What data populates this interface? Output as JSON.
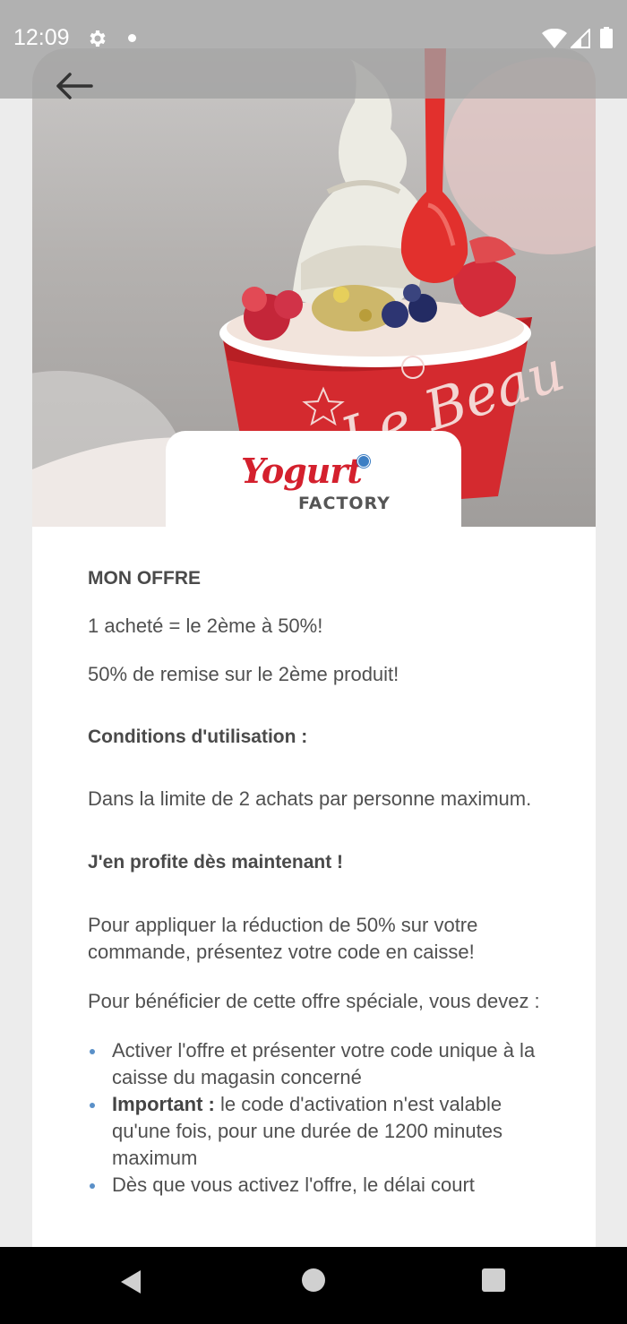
{
  "status_bar": {
    "time": "12:09",
    "icons": [
      "gear-icon",
      "dot-icon",
      "wifi-icon",
      "signal-icon",
      "battery-icon"
    ]
  },
  "header": {
    "back_icon": "arrow-left-icon"
  },
  "hero": {
    "cup_text": "Le Beau"
  },
  "brand": {
    "logo_script": "Yogurt",
    "logo_sub": "FACTORY"
  },
  "offer": {
    "title": "MON OFFRE",
    "deal": "1 acheté = le 2ème à 50%!",
    "deal_detail": "50% de remise sur le 2ème produit!",
    "conditions_title": "Conditions d'utilisation :",
    "conditions_text": "Dans la limite de 2 achats par personne maximum.",
    "cta_title": "J'en profite dès maintenant !",
    "cta_text": "Pour appliquer la réduction de 50% sur votre commande, présentez votre code en caisse!",
    "steps_intro": "Pour bénéficier de cette offre spéciale, vous devez :",
    "bullets": [
      {
        "text": "Activer l'offre et présenter votre code unique à la caisse du magasin concerné"
      },
      {
        "bold": "Important :",
        "text": " le code d'activation n'est valable qu'une fois, pour une durée de 1200 minutes maximum"
      },
      {
        "text": "Dès que vous activez l'offre, le délai court"
      }
    ]
  },
  "nav": {
    "icons": [
      "nav-back-icon",
      "nav-home-icon",
      "nav-recents-icon"
    ]
  },
  "colors": {
    "brand_red": "#d4202d",
    "bullet_blue": "#5a90c8",
    "text": "#505050"
  }
}
